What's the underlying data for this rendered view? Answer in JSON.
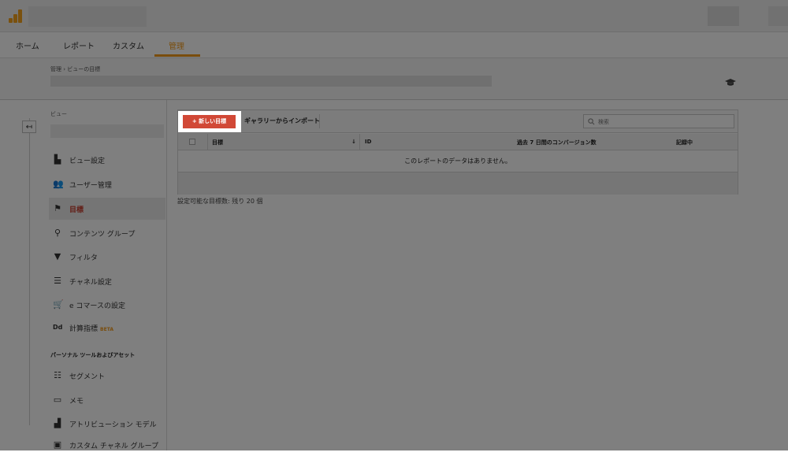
{
  "nav": {
    "tabs": [
      {
        "label": "ホーム"
      },
      {
        "label": "レポート"
      },
      {
        "label": "カスタム"
      },
      {
        "label": "管理"
      }
    ]
  },
  "breadcrumb": "管理 › ビューの目標",
  "left": {
    "view_label": "ビュー",
    "items": [
      {
        "label": "ビュー設定",
        "icon": "document-icon"
      },
      {
        "label": "ユーザー管理",
        "icon": "users-icon"
      },
      {
        "label": "目標",
        "icon": "flag-icon"
      },
      {
        "label": "コンテンツ グループ",
        "icon": "content-group-icon"
      },
      {
        "label": "フィルタ",
        "icon": "filter-icon"
      },
      {
        "label": "チャネル設定",
        "icon": "channel-icon"
      },
      {
        "label": "e コマースの設定",
        "icon": "cart-icon"
      },
      {
        "label": "計算指標",
        "icon": "calculated-icon",
        "badge": "BETA"
      }
    ],
    "section_title": "パーソナル ツールおよびアセット",
    "personal_items": [
      {
        "label": "セグメント",
        "icon": "segment-icon"
      },
      {
        "label": "メモ",
        "icon": "memo-icon"
      },
      {
        "label": "アトリビューション モデル",
        "icon": "attribution-icon"
      },
      {
        "label": "カスタム チャネル グループ",
        "icon": "custom-channel-icon"
      }
    ]
  },
  "toolbar": {
    "new_goal_label": "+ 新しい目標",
    "import_label": "ギャラリーからインポート",
    "search_placeholder": "検索"
  },
  "table": {
    "columns": [
      "目標",
      "ID",
      "過去 7 日間のコンバージョン数",
      "記録中"
    ],
    "empty_message": "このレポートのデータはありません。"
  },
  "remaining_text": "設定可能な目標数: 残り 20 個",
  "colors": {
    "accent": "#f29a1b",
    "primary_button": "#d14836",
    "active_text": "#c73e2f"
  }
}
